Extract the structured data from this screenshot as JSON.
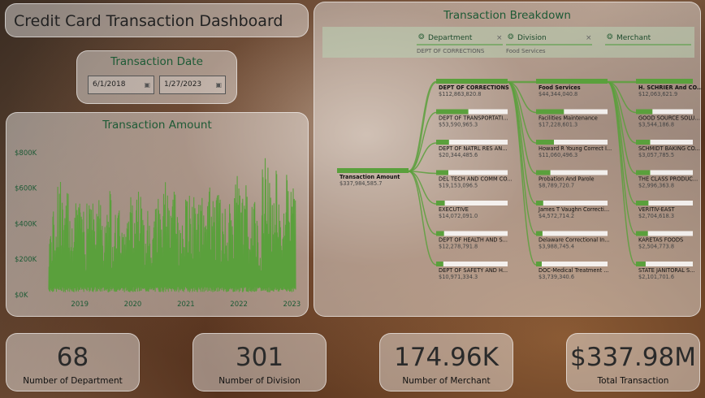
{
  "title": "Credit Card Transaction Dashboard",
  "date_filter": {
    "label": "Transaction Date",
    "start": "6/1/2018",
    "end": "1/27/2023"
  },
  "amount_chart": {
    "title": "Transaction Amount",
    "y_ticks": [
      "$800K",
      "$600K",
      "$400K",
      "$200K",
      "$0K"
    ],
    "x_ticks": [
      "2019",
      "2020",
      "2021",
      "2022",
      "2023"
    ]
  },
  "chart_data": {
    "type": "line",
    "title": "Transaction Amount",
    "xlabel": "",
    "ylabel": "",
    "ylim": [
      0,
      850000
    ],
    "xlim": [
      "2018-06-01",
      "2023-01-27"
    ],
    "x_ticks": [
      "2019",
      "2020",
      "2021",
      "2022",
      "2023"
    ],
    "y_ticks": [
      0,
      200000,
      400000,
      600000,
      800000
    ],
    "grid": false,
    "color": "#5aa03c",
    "series": [
      {
        "points": [
          [
            "2018-06",
            330000
          ],
          [
            "2018-07",
            560000
          ],
          [
            "2018-08",
            700000
          ],
          [
            "2018-09",
            380000
          ],
          [
            "2018-10",
            660000
          ],
          [
            "2018-11",
            300000
          ],
          [
            "2018-12",
            620000
          ],
          [
            "2019-01",
            420000
          ],
          [
            "2019-02",
            580000
          ],
          [
            "2019-03",
            720000
          ],
          [
            "2019-04",
            350000
          ],
          [
            "2019-05",
            600000
          ],
          [
            "2019-06",
            280000
          ],
          [
            "2019-07",
            640000
          ],
          [
            "2019-08",
            500000
          ],
          [
            "2019-09",
            420000
          ],
          [
            "2019-10",
            530000
          ],
          [
            "2019-11",
            320000
          ],
          [
            "2019-12",
            560000
          ],
          [
            "2020-01",
            460000
          ],
          [
            "2020-02",
            630000
          ],
          [
            "2020-03",
            380000
          ],
          [
            "2020-04",
            520000
          ],
          [
            "2020-05",
            290000
          ],
          [
            "2020-06",
            570000
          ],
          [
            "2020-07",
            470000
          ],
          [
            "2020-08",
            650000
          ],
          [
            "2020-09",
            420000
          ],
          [
            "2020-10",
            600000
          ],
          [
            "2020-11",
            340000
          ],
          [
            "2020-12",
            550000
          ],
          [
            "2021-01",
            520000
          ],
          [
            "2021-02",
            630000
          ],
          [
            "2021-03",
            400000
          ],
          [
            "2021-04",
            610000
          ],
          [
            "2021-05",
            350000
          ],
          [
            "2021-06",
            660000
          ],
          [
            "2021-07",
            480000
          ],
          [
            "2021-08",
            590000
          ],
          [
            "2021-09",
            430000
          ],
          [
            "2021-10",
            620000
          ],
          [
            "2021-11",
            370000
          ],
          [
            "2021-12",
            700000
          ],
          [
            "2022-01",
            520000
          ],
          [
            "2022-02",
            650000
          ],
          [
            "2022-03",
            410000
          ],
          [
            "2022-04",
            560000
          ],
          [
            "2022-05",
            350000
          ],
          [
            "2022-06",
            740000
          ],
          [
            "2022-07",
            810000
          ],
          [
            "2022-08",
            470000
          ],
          [
            "2022-09",
            720000
          ],
          [
            "2022-10",
            380000
          ],
          [
            "2022-11",
            760000
          ],
          [
            "2022-12",
            520000
          ],
          [
            "2023-01",
            690000
          ]
        ]
      }
    ]
  },
  "breakdown": {
    "title": "Transaction Breakdown",
    "filters": [
      {
        "label": "Department",
        "value": "DEPT OF CORRECTIONS"
      },
      {
        "label": "Division",
        "value": "Food Services"
      },
      {
        "label": "Merchant",
        "value": ""
      }
    ],
    "root": {
      "label": "Transaction Amount",
      "value": "$337,984,585.7"
    },
    "departments": [
      {
        "label": "DEPT OF CORRECTIONS",
        "value": "$112,863,820.8"
      },
      {
        "label": "DEPT OF TRANSPORTATI...",
        "value": "$53,590,965.3"
      },
      {
        "label": "DEPT OF NATRL RES AN...",
        "value": "$20,344,485.6"
      },
      {
        "label": "DEL TECH AND COMM CO...",
        "value": "$19,153,096.5"
      },
      {
        "label": "EXECUTIVE",
        "value": "$14,072,091.0"
      },
      {
        "label": "DEPT OF HEALTH AND S...",
        "value": "$12,278,791.8"
      },
      {
        "label": "DEPT OF SAFETY AND H...",
        "value": "$10,971,334.3"
      }
    ],
    "divisions": [
      {
        "label": "Food Services",
        "value": "$44,344,040.8"
      },
      {
        "label": "Facilities Maintenance",
        "value": "$17,228,601.3"
      },
      {
        "label": "Howard R Young Correct I...",
        "value": "$11,060,496.3"
      },
      {
        "label": "Probation And Parole",
        "value": "$8,789,720.7"
      },
      {
        "label": "James T Vaughn Correcti...",
        "value": "$4,572,714.2"
      },
      {
        "label": "Delaware Correctional In...",
        "value": "$3,988,745.4"
      },
      {
        "label": "DOC-Medical Treatment ...",
        "value": "$3,739,340.6"
      }
    ],
    "merchants": [
      {
        "label": "H. SCHRIER And CO...",
        "value": "$12,063,621.9"
      },
      {
        "label": "GOOD SOURCE SOLU...",
        "value": "$3,544,186.8"
      },
      {
        "label": "SCHMIDT BAKING CO...",
        "value": "$3,057,785.5"
      },
      {
        "label": "THE CLASS PRODUC...",
        "value": "$2,996,363.8"
      },
      {
        "label": "VERITIV-EAST",
        "value": "$2,704,618.3"
      },
      {
        "label": "KARETAS FOODS",
        "value": "$2,504,773.8"
      },
      {
        "label": "STATE JANITORAL S...",
        "value": "$2,101,701.6"
      }
    ]
  },
  "kpis": [
    {
      "value": "68",
      "label": "Number of Department"
    },
    {
      "value": "301",
      "label": "Number of Division"
    },
    {
      "value": "174.96K",
      "label": "Number of Merchant"
    },
    {
      "value": "$337.98M",
      "label": "Total Transaction"
    }
  ]
}
